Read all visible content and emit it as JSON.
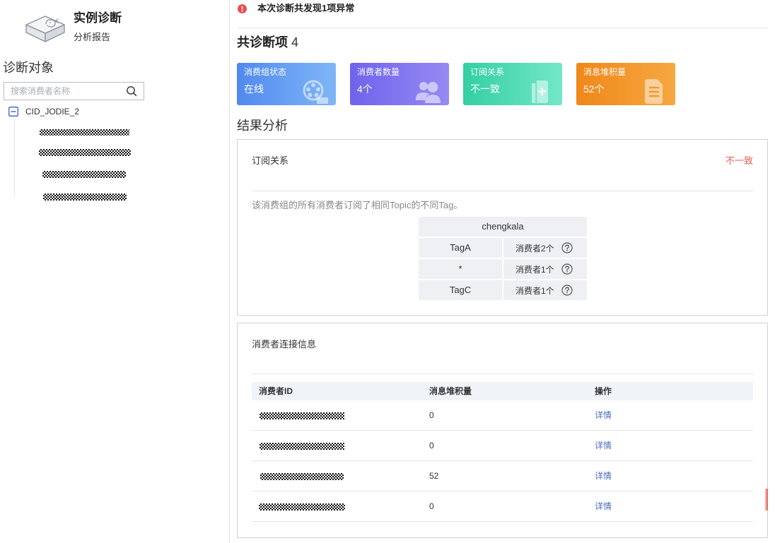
{
  "sidebar": {
    "title": "实例诊断",
    "subtitle": "分析报告",
    "section_title": "诊断对象",
    "search": {
      "placeholder": "搜索消费者名称",
      "value": ""
    },
    "tree": {
      "root_label": "CID_JODIE_2",
      "root_expanded": true
    }
  },
  "alert": {
    "text": "本次诊断共发现1项异常",
    "icon": "error-circle-icon",
    "color": "#e8504f"
  },
  "summary": {
    "label": "共诊断项",
    "count": "4"
  },
  "cards": [
    {
      "label": "消费组状态",
      "value": "在线",
      "icon": "film-reel-icon",
      "color_start": "#5189f0",
      "color_end": "#80b6f6"
    },
    {
      "label": "消费者数量",
      "value": "4个",
      "icon": "users-icon",
      "color_start": "#6f63ec",
      "color_end": "#968af4"
    },
    {
      "label": "订阅关系",
      "value": "不一致",
      "icon": "document-add-icon",
      "color_start": "#33cfa2",
      "color_end": "#74e7c9"
    },
    {
      "label": "消息堆积量",
      "value": "52个",
      "icon": "document-list-icon",
      "color_start": "#f08719",
      "color_end": "#f6a842"
    }
  ],
  "results_title": "结果分析",
  "subscription_panel": {
    "title": "订阅关系",
    "status": "不一致",
    "status_color": "#ee5a52",
    "description": "该消费组的所有消费者订阅了相同Topic的不同Tag。",
    "topic": "chengkala",
    "rows": [
      {
        "tag": "TagA",
        "consumers": "消费者2个"
      },
      {
        "tag": "*",
        "consumers": "消费者1个"
      },
      {
        "tag": "TagC",
        "consumers": "消费者1个"
      }
    ]
  },
  "connection_panel": {
    "title": "消费者连接信息",
    "columns": [
      "消费者ID",
      "消息堆积量",
      "操作"
    ],
    "rows": [
      {
        "backlog": "0",
        "action": "详情"
      },
      {
        "backlog": "0",
        "action": "详情"
      },
      {
        "backlog": "52",
        "action": "详情"
      },
      {
        "backlog": "0",
        "action": "详情"
      }
    ],
    "link_color": "#4a6cc5"
  }
}
